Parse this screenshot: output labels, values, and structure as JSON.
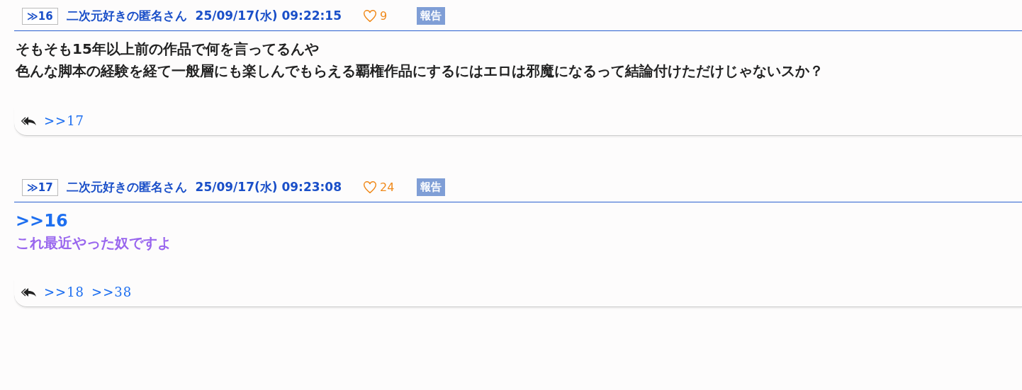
{
  "posts": [
    {
      "number": "≫16",
      "author": "二次元好きの匿名さん",
      "date": "25/09/17(水) 09:22:15",
      "likes": "9",
      "report": "報告",
      "lines": [
        {
          "kind": "text",
          "text": "そもそも15年以上前の作品で何を言ってるんや",
          "color": "#222222"
        },
        {
          "kind": "text",
          "text": "色んな脚本の経験を経て一般層にも楽しんでもらえる覇権作品にするにはエロは邪魔になるって結論付けただけじゃないスか？",
          "color": "#222222"
        }
      ],
      "replies": [
        ">>17"
      ]
    },
    {
      "number": "≫17",
      "author": "二次元好きの匿名さん",
      "date": "25/09/17(水) 09:23:08",
      "likes": "24",
      "report": "報告",
      "lines": [
        {
          "kind": "anchor",
          "text": ">>16"
        },
        {
          "kind": "text",
          "text": "これ最近やった奴ですよ",
          "color": "#9966ee"
        }
      ],
      "replies": [
        ">>18",
        ">>38"
      ]
    }
  ]
}
